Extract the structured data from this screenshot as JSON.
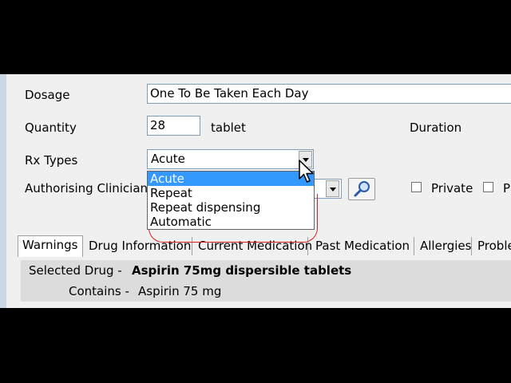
{
  "form": {
    "dosage_label": "Dosage",
    "dosage_value": "One To Be Taken Each Day",
    "quantity_label": "Quantity",
    "quantity_value": "28",
    "quantity_unit": "tablet",
    "duration_label": "Duration",
    "rx_types_label": "Rx Types",
    "rx_types_value": "Acute",
    "authorising_label": "Authorising Clinician",
    "private_label": "Private",
    "cut_checkbox_label": "P"
  },
  "dropdown": {
    "options": [
      "Acute",
      "Repeat",
      "Repeat dispensing",
      "Automatic"
    ],
    "selected_index": 0
  },
  "tabs": [
    "Warnings",
    "Drug Information",
    "Current Medication",
    "Past Medication",
    "Allergies",
    "Proble"
  ],
  "active_tab": "Warnings",
  "detail": {
    "selected_drug_label": "Selected Drug -",
    "selected_drug_value": "Aspirin 75mg dispersible tablets",
    "contains_label": "Contains -",
    "contains_value": "Aspirin 75 mg"
  },
  "colors": {
    "selection": "#3399ff",
    "annotation": "#d82020"
  }
}
